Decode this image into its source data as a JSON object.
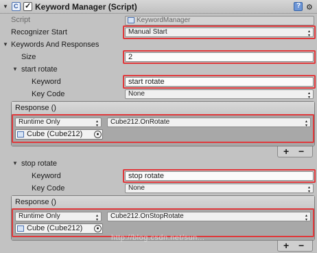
{
  "header": {
    "title": "Keyword Manager (Script)",
    "enabled": true
  },
  "script_row": {
    "label": "Script",
    "value": "KeywordManager"
  },
  "recognizer": {
    "label": "Recognizer Start",
    "value": "Manual Start"
  },
  "keywords": {
    "label": "Keywords And Responses",
    "size_label": "Size",
    "size_value": "2",
    "items": [
      {
        "name": "start rotate",
        "keyword_label": "Keyword",
        "keyword_value": "start rotate",
        "keycode_label": "Key Code",
        "keycode_value": "None",
        "response_label": "Response ()",
        "runtime": "Runtime Only",
        "function": "Cube212.OnRotate",
        "object": "Cube (Cube212)"
      },
      {
        "name": "stop rotate",
        "keyword_label": "Keyword",
        "keyword_value": "stop rotate",
        "keycode_label": "Key Code",
        "keycode_value": "None",
        "response_label": "Response ()",
        "runtime": "Runtime Only",
        "function": "Cube212.OnStopRotate",
        "object": "Cube (Cube212)"
      }
    ]
  },
  "list_controls": {
    "add": "+",
    "remove": "−"
  },
  "watermark": "http://blog.csdn.net/sun..."
}
